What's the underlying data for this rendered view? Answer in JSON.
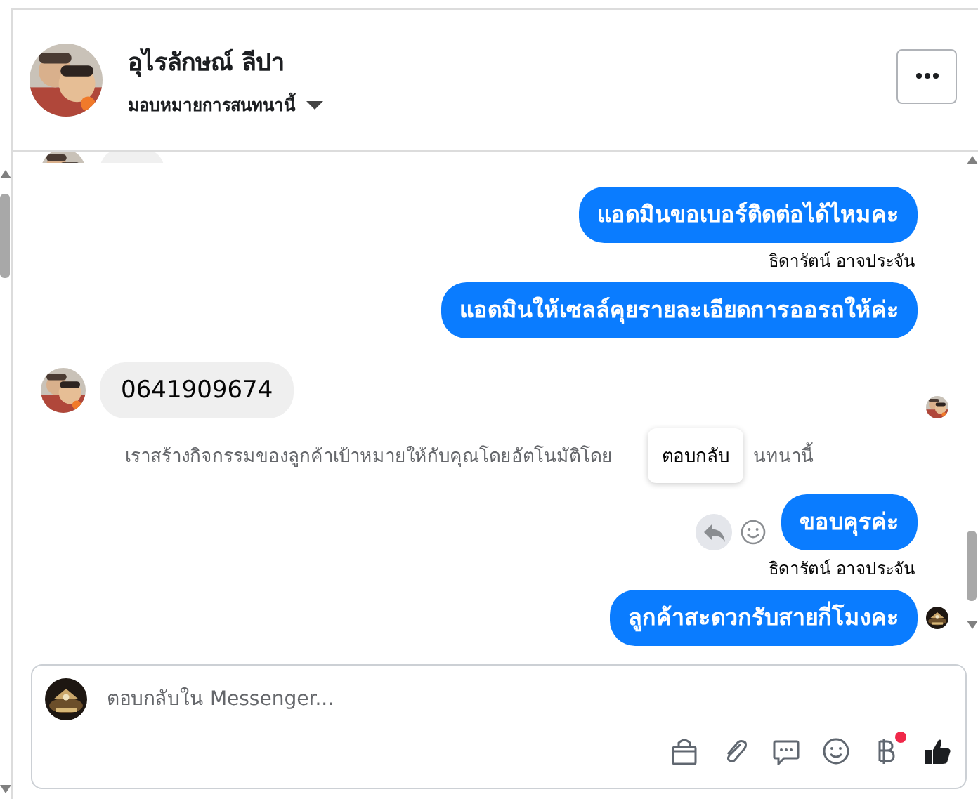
{
  "header": {
    "name": "อุไรลักษณ์ ลีปา",
    "subtitle": "มอบหมายการสนทนานี้"
  },
  "messages": [
    {
      "kind": "cut"
    },
    {
      "kind": "outgoing",
      "text": "แอดมินขอเบอร์ติดต่อได้ไหมคะ"
    },
    {
      "kind": "sender",
      "text": "ธิดารัตน์ อาจประจัน"
    },
    {
      "kind": "outgoing",
      "text": "แอดมินให้เซลล์คุยรายละเอียดการออรถให้ค่ะ"
    },
    {
      "kind": "incoming",
      "text": "0641909674",
      "seen": true
    },
    {
      "kind": "system",
      "parts": [
        "เราสร้างกิจกรรมของลูกค้าเป้าหมายให้กับคุณโดยอัตโนมัติโดย",
        "นทนานี้"
      ],
      "tooltip": "ตอบกลับ"
    },
    {
      "kind": "outgoing",
      "text": "ขอบคุรค่ะ",
      "hovered": true
    },
    {
      "kind": "sender",
      "text": "ธิดารัตน์ อาจประจัน"
    },
    {
      "kind": "outgoing",
      "text": "ลูกค้าสะดวกรับสายกี่โมงคะ",
      "seen": true
    }
  ],
  "composer": {
    "placeholder": "ตอบกลับใน Messenger...",
    "tools": [
      {
        "kind": "bag"
      },
      {
        "kind": "clip"
      },
      {
        "kind": "chat"
      },
      {
        "kind": "smile"
      },
      {
        "kind": "baht",
        "badge": true
      },
      {
        "kind": "like"
      }
    ]
  }
}
